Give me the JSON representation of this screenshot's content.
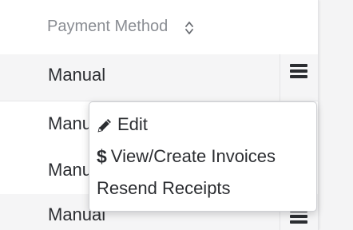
{
  "table": {
    "column_header": "Payment Method",
    "rows": [
      {
        "payment_method": "Manual"
      },
      {
        "payment_method": "Manual"
      },
      {
        "payment_method": "Manual"
      },
      {
        "payment_method": "Manual"
      }
    ]
  },
  "dropdown": {
    "items": [
      {
        "label": "Edit",
        "icon": "pencil-icon"
      },
      {
        "label": "View/Create Invoices",
        "icon": "dollar-icon",
        "glyph": "$"
      },
      {
        "label": "Resend Receipts"
      }
    ]
  },
  "colors": {
    "text": "#2b2d31",
    "header_text": "#8a8d93",
    "row_shade": "#f5f5f6",
    "border": "#e6e6e8"
  }
}
